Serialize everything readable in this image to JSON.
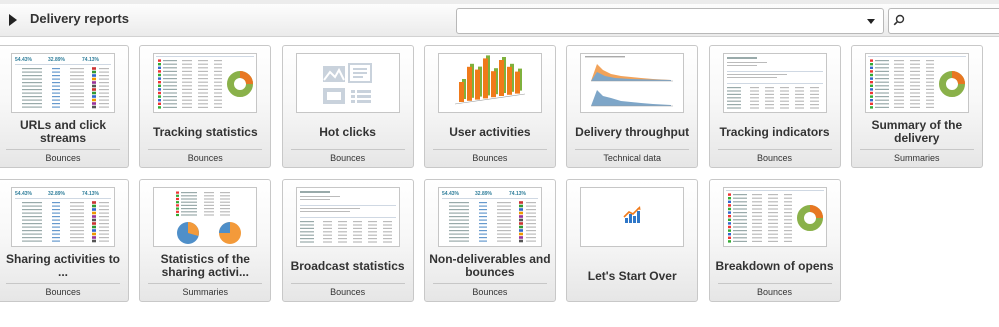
{
  "header": {
    "title": "Delivery reports",
    "dropdown_value": "",
    "search_value": ""
  },
  "tiles": [
    {
      "label": "URLs and click streams",
      "category": "Bounces",
      "thumb": "table-stats"
    },
    {
      "label": "Tracking statistics",
      "category": "Bounces",
      "thumb": "table-donut"
    },
    {
      "label": "Hot clicks",
      "category": "Bounces",
      "thumb": "placeholder"
    },
    {
      "label": "User activities",
      "category": "Bounces",
      "thumb": "bar3d"
    },
    {
      "label": "Delivery throughput",
      "category": "Technical data",
      "thumb": "area"
    },
    {
      "label": "Tracking indicators",
      "category": "Bounces",
      "thumb": "table"
    },
    {
      "label": "Summary of the delivery",
      "category": "Summaries",
      "thumb": "table-donut"
    },
    {
      "label": "Sharing activities to ...",
      "category": "Bounces",
      "thumb": "table-stats"
    },
    {
      "label": "Statistics of the sharing activi...",
      "category": "Summaries",
      "thumb": "pies"
    },
    {
      "label": "Broadcast statistics",
      "category": "Bounces",
      "thumb": "table"
    },
    {
      "label": "Non-deliverables and bounces",
      "category": "Bounces",
      "thumb": "table-stats"
    },
    {
      "label": "Let's Start Over",
      "category": "",
      "thumb": "chart-icon"
    },
    {
      "label": "Breakdown of opens",
      "category": "Bounces",
      "thumb": "table-donut"
    }
  ],
  "colors": {
    "donut_green": "#8ab14a",
    "donut_orange": "#e87722",
    "bar_orange": "#f07a1a",
    "bar_green": "#7fb13d",
    "area_orange": "#f2a35a",
    "area_blue": "#7ea6c8",
    "pie_blue": "#4f8fc9",
    "pie_orange": "#f39a3a",
    "stat_teal": "#2e7d9a"
  }
}
